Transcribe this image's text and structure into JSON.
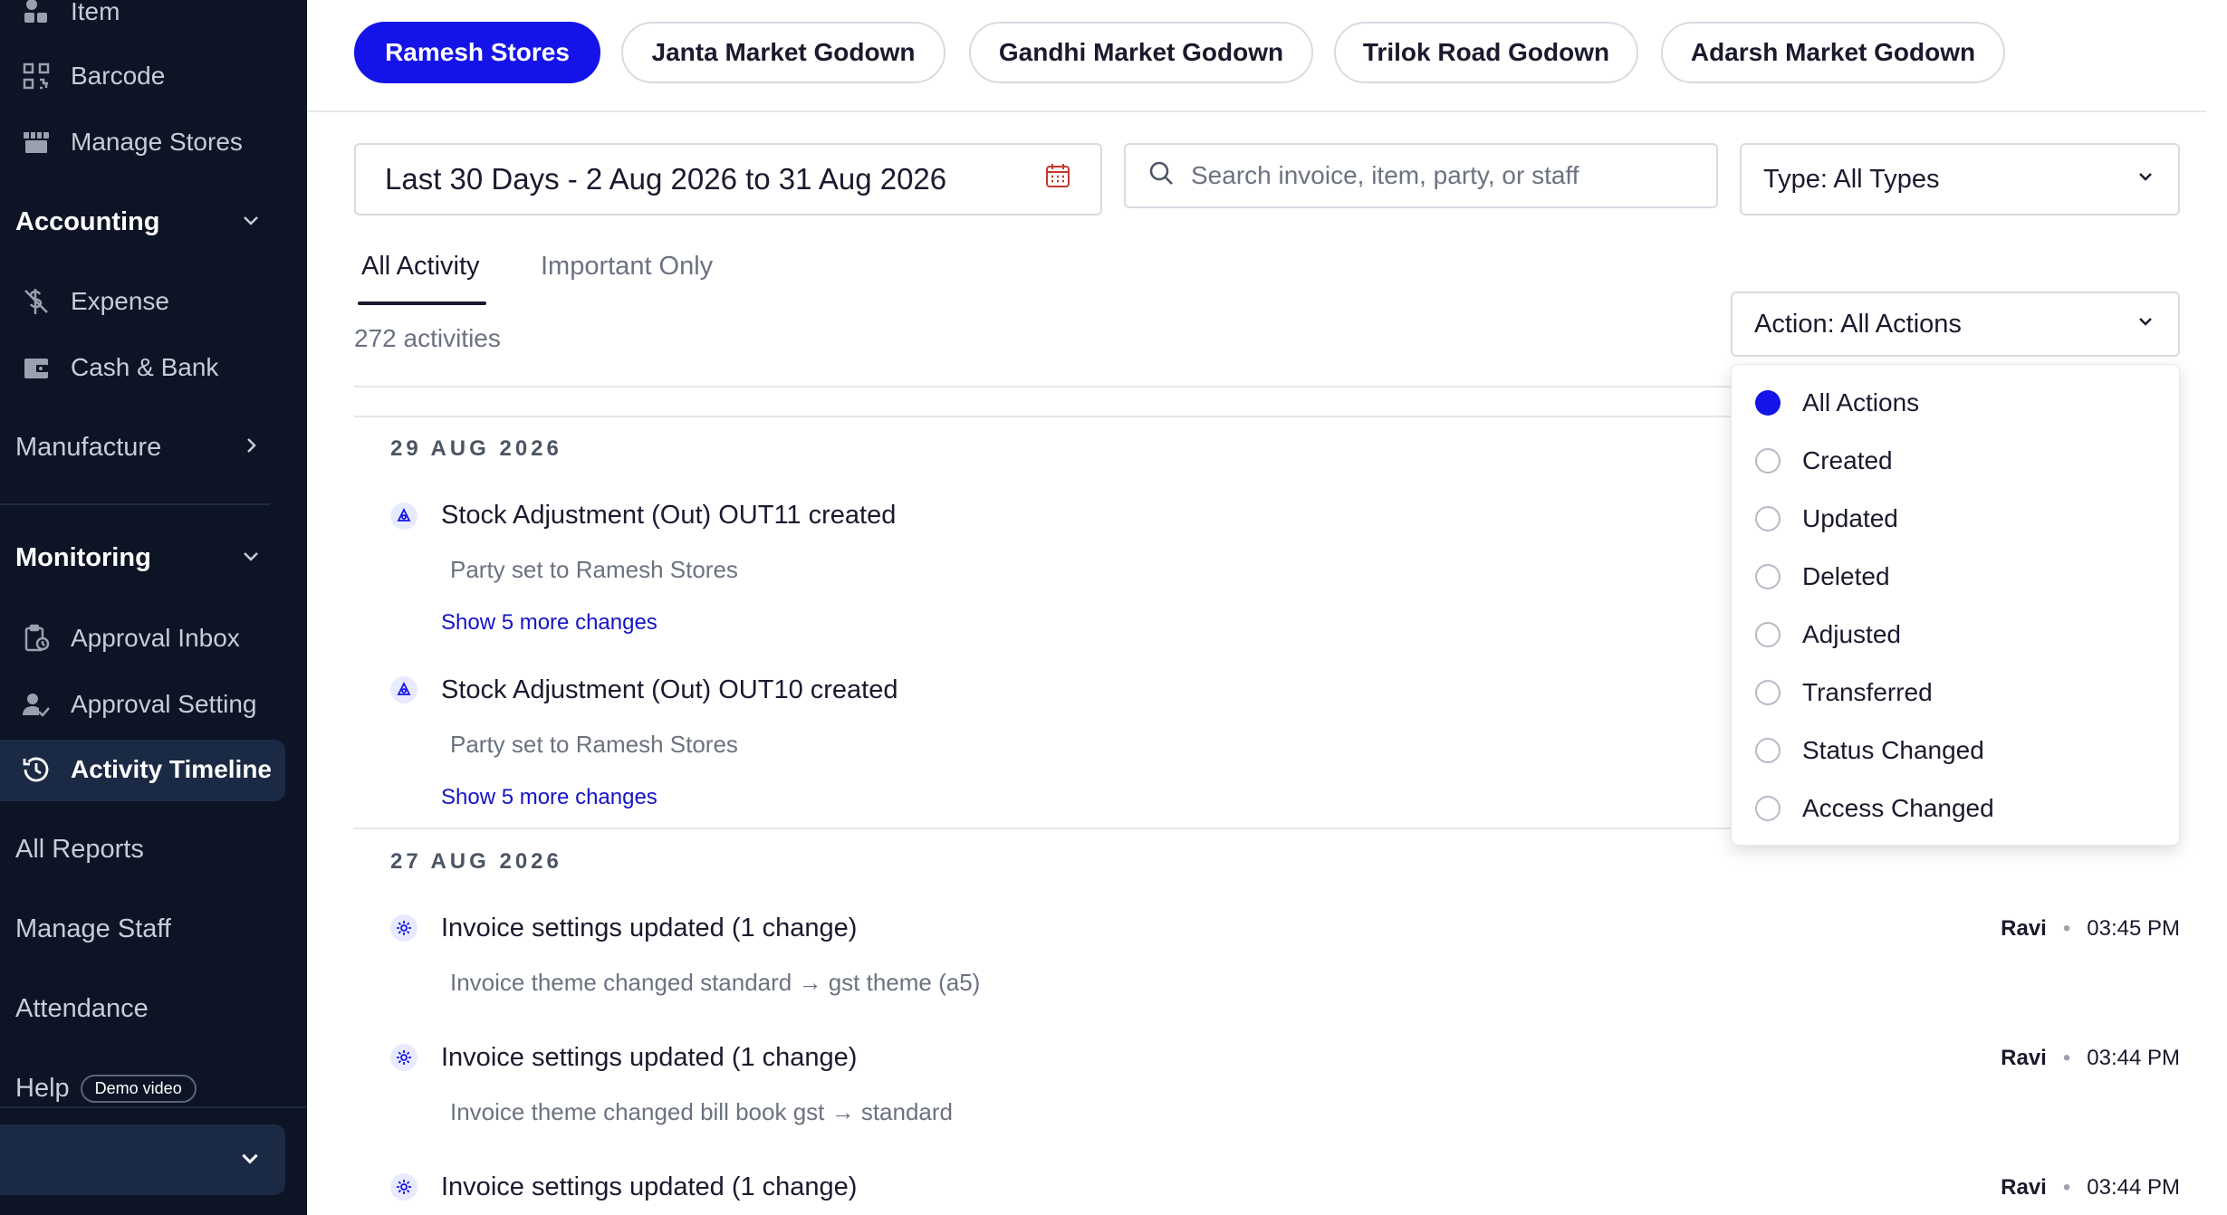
{
  "sidebar": {
    "item_label": "Item",
    "barcode_label": "Barcode",
    "manage_stores_label": "Manage Stores",
    "accounting_label": "Accounting",
    "expense_label": "Expense",
    "cash_bank_label": "Cash & Bank",
    "manufacture_label": "Manufacture",
    "monitoring_label": "Monitoring",
    "approval_inbox_label": "Approval Inbox",
    "approval_setting_label": "Approval Setting",
    "activity_timeline_label": "Activity Timeline",
    "all_reports_label": "All Reports",
    "manage_staff_label": "Manage Staff",
    "attendance_label": "Attendance",
    "help_label": "Help",
    "demo_video_label": "Demo video"
  },
  "stores": [
    "Ramesh Stores",
    "Janta Market Godown",
    "Gandhi Market Godown",
    "Trilok Road Godown",
    "Adarsh Market Godown"
  ],
  "active_store": "Ramesh Stores",
  "filters": {
    "date_range": "Last 30 Days - 2 Aug 2026 to 31 Aug 2026",
    "search_placeholder": "Search invoice, item, party, or staff",
    "type_label": "Type: All Types",
    "action_label": "Action: All Actions"
  },
  "view_tabs": {
    "all": "All Activity",
    "important": "Important Only"
  },
  "activity_count": "272 activities",
  "action_options": [
    "All Actions",
    "Created",
    "Updated",
    "Deleted",
    "Adjusted",
    "Transferred",
    "Status Changed",
    "Access Changed"
  ],
  "selected_action": "All Actions",
  "groups": [
    {
      "date": "29 AUG 2026",
      "entries": [
        {
          "title": "Stock Adjustment (Out) OUT11 created",
          "detail": "Party set to Ramesh Stores",
          "more": "Show 5 more changes"
        },
        {
          "title": "Stock Adjustment (Out) OUT10 created",
          "detail": "Party set to Ramesh Stores",
          "more": "Show 5 more changes"
        }
      ]
    },
    {
      "date": "27 AUG 2026",
      "entries": [
        {
          "title": "Invoice settings updated (1 change)",
          "detail": "Invoice theme changed standard → gst theme (a5)",
          "staff": "Ravi",
          "time": "03:45 PM"
        },
        {
          "title": "Invoice settings updated (1 change)",
          "detail": "Invoice theme changed bill book gst → standard",
          "staff": "Ravi",
          "time": "03:44 PM"
        },
        {
          "title": "Invoice settings updated (1 change)",
          "staff": "Ravi",
          "time": "03:44 PM"
        }
      ]
    }
  ],
  "colors": {
    "sidebar_bg": "#0c1425",
    "accent": "#1414e8",
    "link": "#1414c8"
  }
}
